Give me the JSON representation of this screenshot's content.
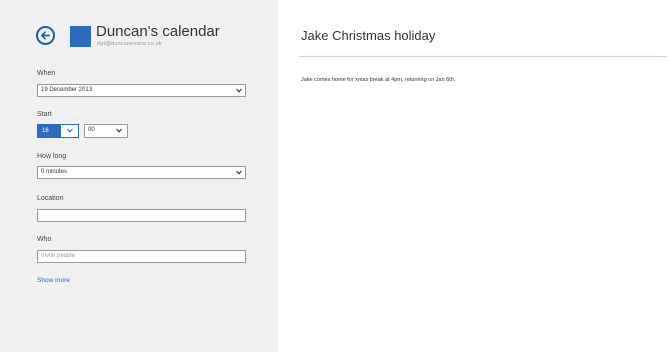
{
  "calendar": {
    "name": "Duncan's calendar",
    "email": "dgt@duncanevans.co.uk",
    "color": "#2d6bbd"
  },
  "form": {
    "when": {
      "label": "When",
      "value": "19 December 2013"
    },
    "start": {
      "label": "Start",
      "hour": "16",
      "minute": "00"
    },
    "how_long": {
      "label": "How long",
      "value": "0 minutes"
    },
    "location": {
      "label": "Location",
      "value": ""
    },
    "who": {
      "label": "Who",
      "placeholder": "Invite people"
    },
    "show_more": "Show more"
  },
  "event": {
    "title": "Jake Christmas holiday",
    "description": "Jake comes home for xmas break at 4pm, returning on Jan 6th."
  },
  "icons": {
    "back": "back-arrow-icon",
    "dropdown": "chevron-down-icon"
  }
}
